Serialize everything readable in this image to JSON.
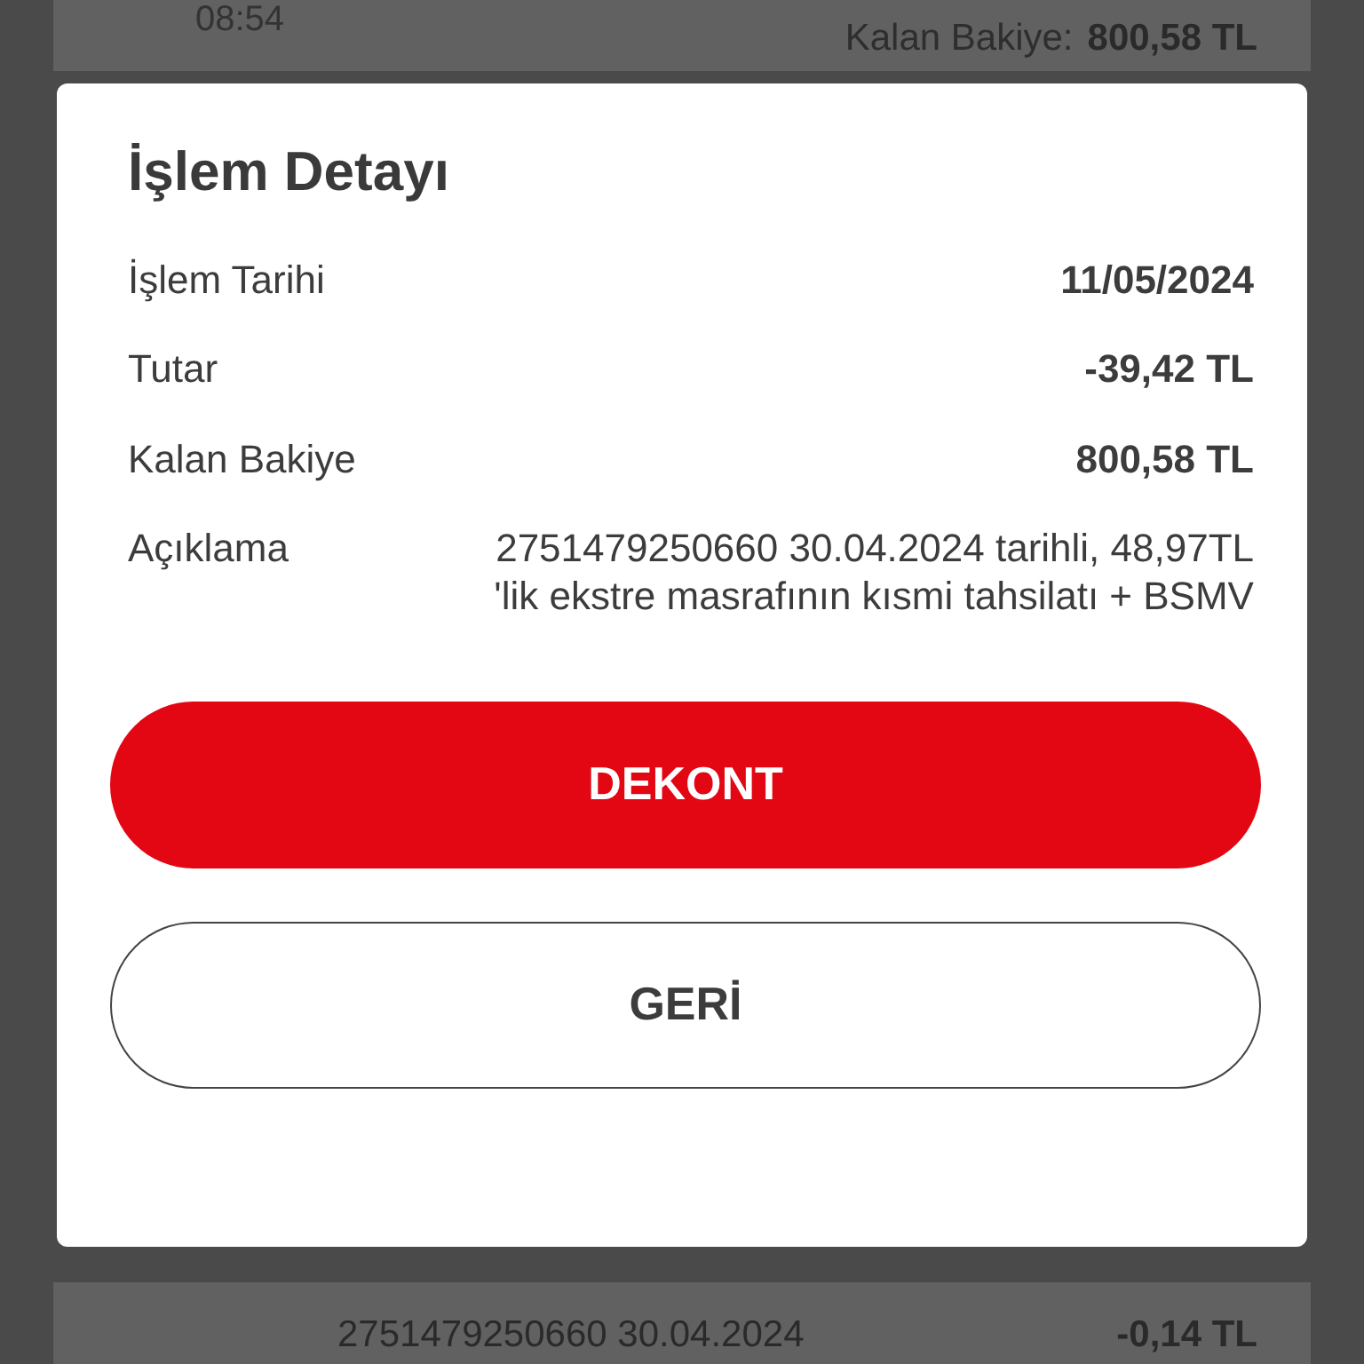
{
  "background": {
    "top_card": {
      "time": "08:54",
      "balance_label": "Kalan Bakiye:",
      "balance_value": "800,58 TL"
    },
    "bottom_card": {
      "description": "2751479250660 30.04.2024",
      "amount": "-0,14 TL"
    }
  },
  "dialog": {
    "title": "İşlem Detayı",
    "rows": [
      {
        "label": "İşlem Tarihi",
        "value": "11/05/2024",
        "kind": "bold"
      },
      {
        "label": "Tutar",
        "value": "-39,42 TL",
        "kind": "bold"
      },
      {
        "label": "Kalan Bakiye",
        "value": "800,58 TL",
        "kind": "bold"
      },
      {
        "label": "Açıklama",
        "value": "2751479250660 30.04.2024 tarihli, 48,97TL 'lik ekstre masrafının kısmi tahsilatı + BSMV",
        "kind": "plain"
      }
    ],
    "buttons": [
      {
        "label": "DEKONT",
        "kind": "primary"
      },
      {
        "label": "GERİ",
        "kind": "secondary"
      }
    ]
  }
}
